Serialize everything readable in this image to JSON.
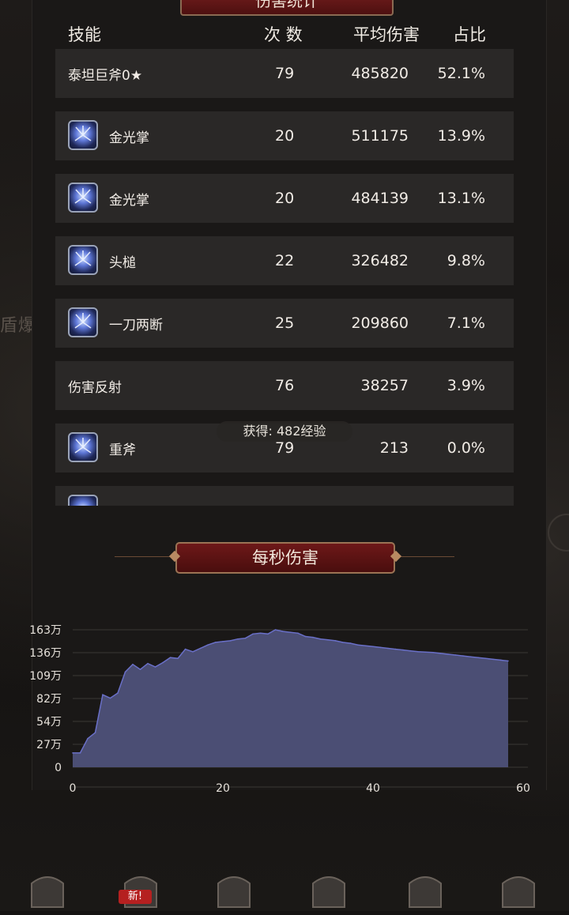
{
  "panel_title": "伤害统计",
  "header": {
    "skill": "技能",
    "count": "次 数",
    "avg": "平均伤害",
    "pct": "占比"
  },
  "rows": [
    {
      "name": "泰坦巨斧0★",
      "icon": "",
      "count": "79",
      "avg": "485820",
      "pct": "52.1%"
    },
    {
      "name": "金光掌",
      "icon": "golden-palm-skill-icon",
      "count": "20",
      "avg": "511175",
      "pct": "13.9%"
    },
    {
      "name": "金光掌",
      "icon": "golden-palm-skill-icon",
      "count": "20",
      "avg": "484139",
      "pct": "13.1%"
    },
    {
      "name": "头槌",
      "icon": "headbutt-skill-icon",
      "count": "22",
      "avg": "326482",
      "pct": "9.8%"
    },
    {
      "name": "一刀两断",
      "icon": "slash-skill-icon",
      "count": "25",
      "avg": "209860",
      "pct": "7.1%"
    },
    {
      "name": "伤害反射",
      "icon": "",
      "count": "76",
      "avg": "38257",
      "pct": "3.9%"
    },
    {
      "name": "重斧",
      "icon": "heavy-axe-skill-icon",
      "count": "79",
      "avg": "213",
      "pct": "0.0%"
    }
  ],
  "toast": "获得: 482经验",
  "dps_title": "每秒伤害",
  "chart_data": {
    "type": "area",
    "title": "每秒伤害",
    "xlim": [
      0,
      60
    ],
    "xticks": [
      "0",
      "20",
      "40",
      "60"
    ],
    "ylim": [
      0,
      1630000
    ],
    "yticks": [
      "0",
      "27万",
      "54万",
      "82万",
      "109万",
      "136万",
      "163万"
    ],
    "grid": true,
    "series": [
      {
        "fill": "#4b4e74",
        "stroke": "#6a70c8",
        "x": [
          0,
          1,
          2,
          3,
          4,
          5,
          6,
          7,
          8,
          9,
          10,
          11,
          12,
          13,
          14,
          15,
          16,
          17,
          18,
          19,
          20,
          21,
          22,
          23,
          24,
          25,
          26,
          27,
          28,
          29,
          30,
          31,
          32,
          33,
          34,
          35,
          36,
          37,
          38,
          39,
          40,
          41,
          42,
          43,
          44,
          45,
          46,
          47,
          48,
          49,
          50,
          51,
          52,
          53,
          54,
          55,
          56,
          57,
          58
        ],
        "y": [
          170000,
          170000,
          340000,
          410000,
          860000,
          820000,
          880000,
          1130000,
          1220000,
          1160000,
          1230000,
          1190000,
          1240000,
          1300000,
          1290000,
          1400000,
          1370000,
          1410000,
          1450000,
          1480000,
          1490000,
          1500000,
          1520000,
          1530000,
          1580000,
          1590000,
          1580000,
          1630000,
          1610000,
          1600000,
          1590000,
          1550000,
          1540000,
          1520000,
          1510000,
          1500000,
          1480000,
          1470000,
          1450000,
          1440000,
          1430000,
          1420000,
          1410000,
          1400000,
          1390000,
          1380000,
          1370000,
          1365000,
          1360000,
          1350000,
          1340000,
          1330000,
          1320000,
          1310000,
          1300000,
          1290000,
          1280000,
          1270000,
          1260000
        ]
      }
    ]
  },
  "tabs": [
    {
      "name": "tab-helmet"
    },
    {
      "name": "tab-chest",
      "badge": "新!"
    },
    {
      "name": "tab-shield"
    },
    {
      "name": "tab-scroll"
    },
    {
      "name": "tab-castle"
    },
    {
      "name": "tab-dice"
    }
  ]
}
